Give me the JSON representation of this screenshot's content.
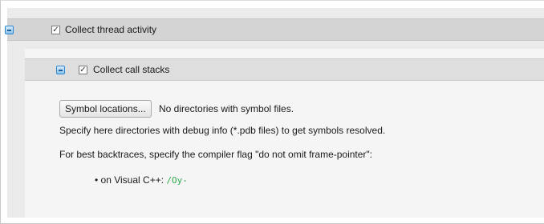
{
  "outer": {
    "checkbox_mark": "✓",
    "label": "Collect thread activity"
  },
  "inner": {
    "checkbox_mark": "✓",
    "label": "Collect call stacks"
  },
  "symbols": {
    "button_label": "Symbol locations...",
    "status_text": "No directories with symbol files.",
    "hint_text": "Specify here directories with debug info (*.pdb files) to get symbols resolved.",
    "backtrace_text": "For best backtraces, specify the compiler flag \"do not omit frame-pointer\":",
    "bullet_glyph": "•",
    "bullet_text": "on Visual C++:",
    "bullet_flag": "/Oy-"
  },
  "colors": {
    "flag_green": "#2fa84a",
    "collapse_blue": "#2d86cf"
  }
}
